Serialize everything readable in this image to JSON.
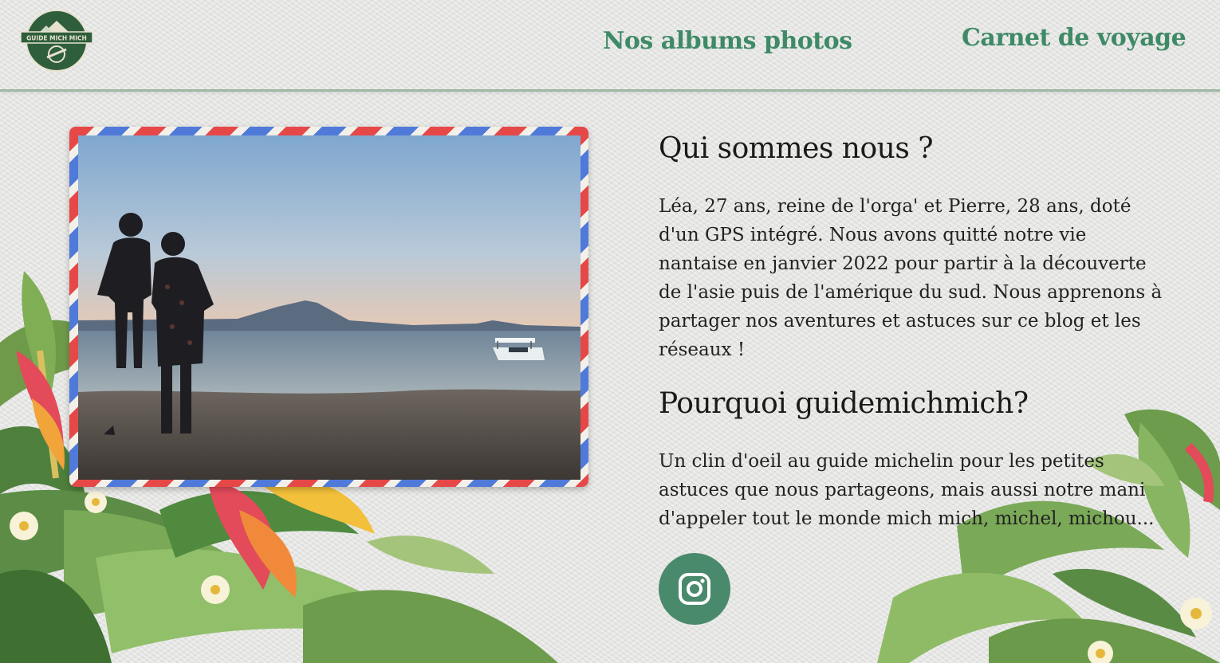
{
  "header": {
    "logo_text": "GUIDE MICH MICH",
    "nav": [
      {
        "label": "Nos albums photos"
      },
      {
        "label": "Carnet de voyage"
      }
    ]
  },
  "about": {
    "title": "Qui sommes nous ?",
    "text": "Léa, 27 ans, reine de l'orga' et Pierre, 28 ans, doté d'un GPS intégré. Nous avons quitté notre vie nantaise en janvier 2022 pour partir à la découverte de l'asie puis de l'amérique du sud. Nous apprenons à partager nos aventures et astuces sur ce blog et les réseaux !"
  },
  "why": {
    "title": "Pourquoi guidemichmich?",
    "text": "Un clin d'oeil au guide michelin pour les petites astuces que nous partageons, mais aussi notre mani d'appeler tout le monde mich mich, michel, michou..."
  },
  "social": {
    "icon": "instagram-icon",
    "color": "#4a8a6c"
  },
  "colors": {
    "accent": "#3f8a66",
    "airmail_red": "#e64848",
    "airmail_blue": "#4f7ad9"
  }
}
